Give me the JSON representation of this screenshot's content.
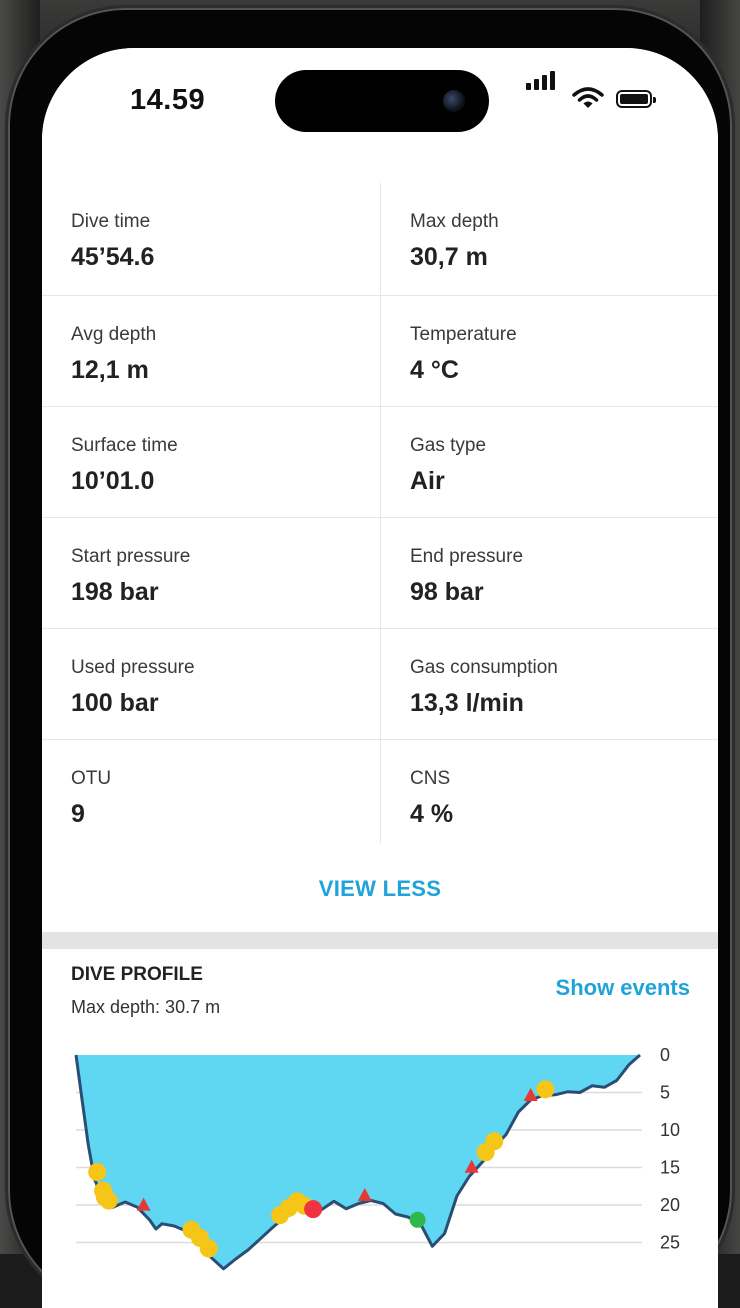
{
  "status_bar": {
    "time": "14.59"
  },
  "stats": [
    {
      "label": "Dive time",
      "value": "45’54.6"
    },
    {
      "label": "Max depth",
      "value": "30,7 m"
    },
    {
      "label": "Avg depth",
      "value": "12,1 m"
    },
    {
      "label": "Temperature",
      "value": "4 °C"
    },
    {
      "label": "Surface time",
      "value": "10’01.0"
    },
    {
      "label": "Gas type",
      "value": "Air"
    },
    {
      "label": "Start pressure",
      "value": "198 bar"
    },
    {
      "label": "End pressure",
      "value": "98 bar"
    },
    {
      "label": "Used pressure",
      "value": "100 bar"
    },
    {
      "label": "Gas consumption",
      "value": "13,3 l/min"
    },
    {
      "label": "OTU",
      "value": "9"
    },
    {
      "label": "CNS",
      "value": "4 %"
    }
  ],
  "view_less_label": "VIEW LESS",
  "profile": {
    "title": "DIVE PROFILE",
    "show_events_label": "Show events",
    "max_depth_text": "Max depth: 30.7 m"
  },
  "chart_data": {
    "type": "area",
    "y_ticks": [
      "0",
      "5",
      "10",
      "15",
      "20",
      "25"
    ],
    "ylim": [
      0,
      30.7
    ],
    "y_inverted": true,
    "fill_color": "#5fd6f2",
    "line_color": "#2a4e73",
    "x": [
      0,
      0.5,
      1,
      1.5,
      2,
      3,
      4,
      5,
      6,
      6.5,
      7,
      8,
      9,
      10,
      11,
      12,
      13,
      14,
      15,
      16,
      17,
      18,
      19,
      20,
      21,
      22,
      23,
      24,
      25,
      26,
      27,
      28,
      29,
      30,
      31,
      32,
      33,
      33.5,
      34,
      35,
      36,
      37,
      38,
      39,
      40,
      41,
      42,
      43,
      44,
      45,
      45.9
    ],
    "depth": [
      0,
      6,
      12,
      16.5,
      18.5,
      20.3,
      19.6,
      20.3,
      22,
      23.2,
      22.5,
      22.8,
      23.5,
      25,
      27,
      28.5,
      27.2,
      26,
      24.5,
      23,
      21.6,
      20.3,
      21.3,
      20.6,
      19.5,
      20.5,
      19.8,
      19.4,
      19.8,
      21.2,
      21.6,
      22.4,
      25.5,
      23.8,
      18.8,
      16.2,
      14.4,
      13.5,
      12.4,
      10.6,
      7.6,
      6,
      5.4,
      5.3,
      4.9,
      5,
      4.1,
      4.3,
      3.4,
      1.3,
      0
    ]
  }
}
